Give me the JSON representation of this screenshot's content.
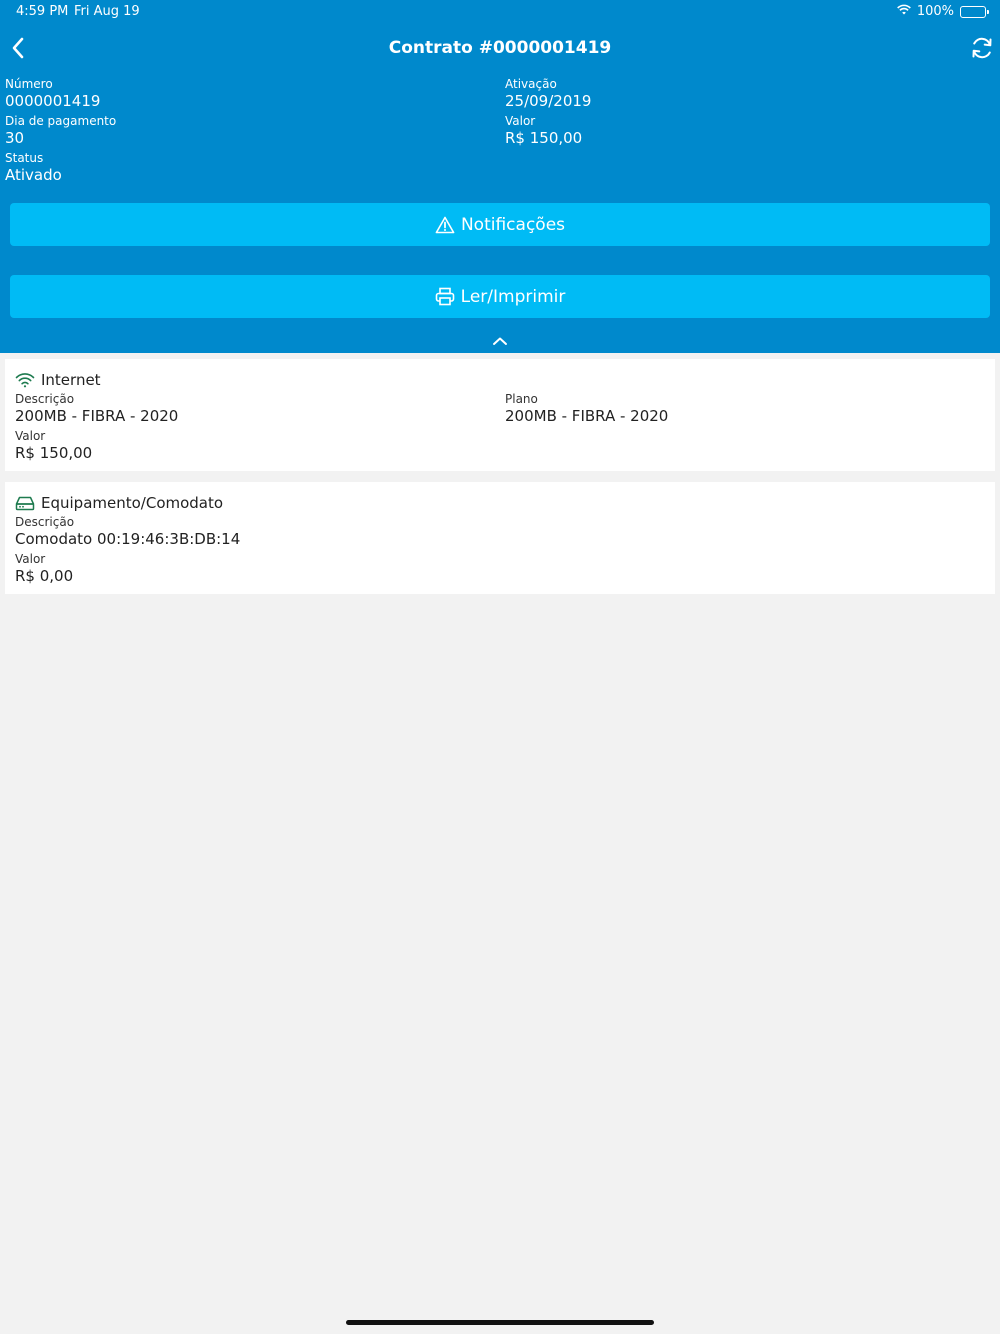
{
  "status_bar": {
    "time": "4:59 PM",
    "date": "Fri Aug 19",
    "battery": "100%"
  },
  "nav": {
    "title": "Contrato #0000001419"
  },
  "contract": {
    "numero": {
      "label": "Número",
      "value": "0000001419"
    },
    "ativacao": {
      "label": "Ativação",
      "value": "25/09/2019"
    },
    "dia_pagamento": {
      "label": "Dia de pagamento",
      "value": "30"
    },
    "valor": {
      "label": "Valor",
      "value": "R$ 150,00"
    },
    "status": {
      "label": "Status",
      "value": "Ativado"
    }
  },
  "actions": {
    "notificacoes": "Notificações",
    "imprimir": "Ler/Imprimir"
  },
  "internet": {
    "title": "Internet",
    "descricao": {
      "label": "Descrição",
      "value": "200MB - FIBRA - 2020"
    },
    "plano": {
      "label": "Plano",
      "value": "200MB - FIBRA - 2020"
    },
    "valor": {
      "label": "Valor",
      "value": "R$ 150,00"
    }
  },
  "equipamento": {
    "title": "Equipamento/Comodato",
    "descricao": {
      "label": "Descrição",
      "value": "Comodato 00:19:46:3B:DB:14"
    },
    "valor": {
      "label": "Valor",
      "value": "R$ 0,00"
    }
  },
  "colors": {
    "header": "#0089cc",
    "button": "#00bbf5",
    "icon_green": "#1e7b4f"
  }
}
